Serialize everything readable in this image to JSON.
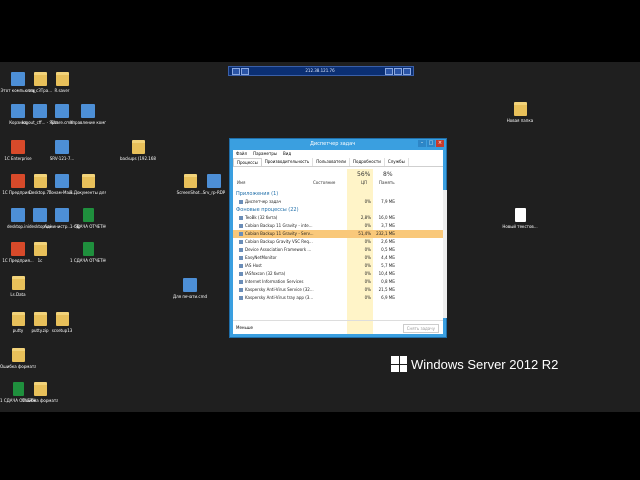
{
  "remote_bar": {
    "title": "212.38.121.76"
  },
  "desktop_icons": [
    {
      "id": "computer",
      "label": "Этот компьютер",
      "kind": "app"
    },
    {
      "id": "sro",
      "label": "sro_сЗТра...",
      "kind": "folder"
    },
    {
      "id": "rsaver",
      "label": "R.saver",
      "kind": "folder"
    },
    {
      "id": "bin",
      "label": "Корзина",
      "kind": "app"
    },
    {
      "id": "logout",
      "label": "logout_cff... - Ярлык",
      "kind": "app"
    },
    {
      "id": "share",
      "label": "Share.cmd",
      "kind": "app"
    },
    {
      "id": "manage",
      "label": "Управление компьюте...",
      "kind": "app"
    },
    {
      "id": "1c",
      "label": "1С Enterprise",
      "kind": "red"
    },
    {
      "id": "srv",
      "label": "SRV-121-7...",
      "kind": "app"
    },
    {
      "id": "backups",
      "label": "backups (192.168.1...",
      "kind": "folder"
    },
    {
      "id": "1c-pred",
      "label": "1С Предприя...",
      "kind": "red"
    },
    {
      "id": "desktop7z",
      "label": "Desktop.7z",
      "kind": "folder"
    },
    {
      "id": "tonam",
      "label": "Тонам-Май...",
      "kind": "app"
    },
    {
      "id": "docs3",
      "label": "3 Документы для предпр...",
      "kind": "folder"
    },
    {
      "id": "screen",
      "label": "ScreenShot...",
      "kind": "folder"
    },
    {
      "id": "srvrdp",
      "label": "Srv_rp-RDP",
      "kind": "app"
    },
    {
      "id": "deskini",
      "label": "desktop.ini",
      "kind": "app"
    },
    {
      "id": "deskpc",
      "label": "desktop.ini",
      "kind": "app"
    },
    {
      "id": "admin",
      "label": "Администр... - Ярлык",
      "kind": "app"
    },
    {
      "id": "sdacha1",
      "label": "1 СДАЧА ОТЧЕТНО...",
      "kind": "xls"
    },
    {
      "id": "1c-pred2",
      "label": "1С Предприя...",
      "kind": "red"
    },
    {
      "id": "1c-2",
      "label": "1с",
      "kind": "folder"
    },
    {
      "id": "sdacha2",
      "label": "1 СДАЧА ОТЧЕТНО...",
      "kind": "xls"
    },
    {
      "id": "dlya",
      "label": "Для печати.cmd",
      "kind": "app"
    },
    {
      "id": "lsdata",
      "label": "Ls.Data",
      "kind": "folder"
    },
    {
      "id": "putty",
      "label": "putty",
      "kind": "folder"
    },
    {
      "id": "puttyzip",
      "label": "putty.zip",
      "kind": "folder"
    },
    {
      "id": "scsetup",
      "label": "scsetup13",
      "kind": "folder"
    },
    {
      "id": "osh1",
      "label": "Ошибка формата ф...",
      "kind": "folder"
    },
    {
      "id": "sdacha3",
      "label": "1 СДАЧА ОТЧЕТНО...",
      "kind": "xls"
    },
    {
      "id": "osh2",
      "label": "Ошибка формата ф...",
      "kind": "folder"
    },
    {
      "id": "newfolder",
      "label": "Новая папка",
      "kind": "folder"
    },
    {
      "id": "newtxt",
      "label": "Новый текстов...",
      "kind": "doc"
    }
  ],
  "taskmgr": {
    "title": "Диспетчер задач",
    "menu": [
      "Файл",
      "Параметры",
      "Вид"
    ],
    "tabs": [
      "Процессы",
      "Производительность",
      "Пользователи",
      "Подробности",
      "Службы"
    ],
    "cols": {
      "name": "Имя",
      "status": "Состояние",
      "cpu_pct": "56%",
      "cpu": "ЦП",
      "mem_pct": "8%",
      "mem": "Память"
    },
    "apps_header": "Приложения (1)",
    "apps": [
      {
        "name": "Диспетчер задач",
        "cpu": "0%",
        "mem": "7,9 МБ"
      }
    ],
    "bg_header": "Фоновые процессы (22)",
    "bg": [
      {
        "name": "TeoBk (32 бита)",
        "cpu": "2,8%",
        "mem": "16,0 МБ"
      },
      {
        "name": "Cobian Backup 11 Gravity - inte...",
        "cpu": "0%",
        "mem": "3,7 МБ"
      },
      {
        "name": "Cobian Backup 11 Gravity - Serv...",
        "cpu": "51,4%",
        "mem": "232,1 МБ"
      },
      {
        "name": "Cobian Backup Gravity VSC Req...",
        "cpu": "0%",
        "mem": "2,6 МБ"
      },
      {
        "name": "Device Association Framework ...",
        "cpu": "0%",
        "mem": "0,5 МБ"
      },
      {
        "name": "EasyNetMonitor",
        "cpu": "0%",
        "mem": "4,4 МБ"
      },
      {
        "name": "IAS Host",
        "cpu": "0%",
        "mem": "5,7 МБ"
      },
      {
        "name": "IASfoxcon (32 бита)",
        "cpu": "0%",
        "mem": "10,4 МБ"
      },
      {
        "name": "Internet Information Services",
        "cpu": "0%",
        "mem": "0,8 МБ"
      },
      {
        "name": "Kaspersky Anti-Virus Service (32...",
        "cpu": "0%",
        "mem": "21,5 МБ"
      },
      {
        "name": "Kaspersky Anti-Virus tray app (3...",
        "cpu": "0%",
        "mem": "6,9 МБ"
      }
    ],
    "less": "Меньше",
    "end_task": "Снять задачу"
  },
  "brand": {
    "text": "Windows Server 2012 R2"
  }
}
